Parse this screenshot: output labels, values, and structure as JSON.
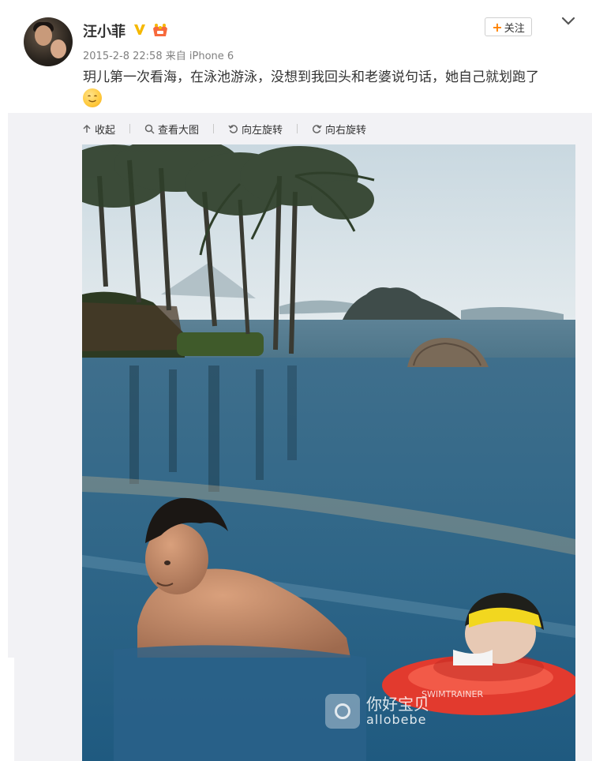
{
  "post": {
    "username": "汪小菲",
    "follow_label": "关注",
    "timestamp": "2015-2-8 22:58",
    "source": "来自 iPhone 6",
    "text": "玥儿第一次看海，在泳池游泳，没想到我回头和老婆说句话，她自己就划跑了",
    "emoji": "smile-emoji"
  },
  "toolbar": {
    "collapse": "收起",
    "view_large": "查看大图",
    "rotate_left": "向左旋转",
    "rotate_right": "向右旋转"
  },
  "watermark": {
    "line1": "你好宝贝",
    "line2": "allobebe"
  },
  "colors": {
    "accent": "#ff8200",
    "verified": "#f5b800",
    "text": "#333333",
    "meta": "#808080"
  }
}
